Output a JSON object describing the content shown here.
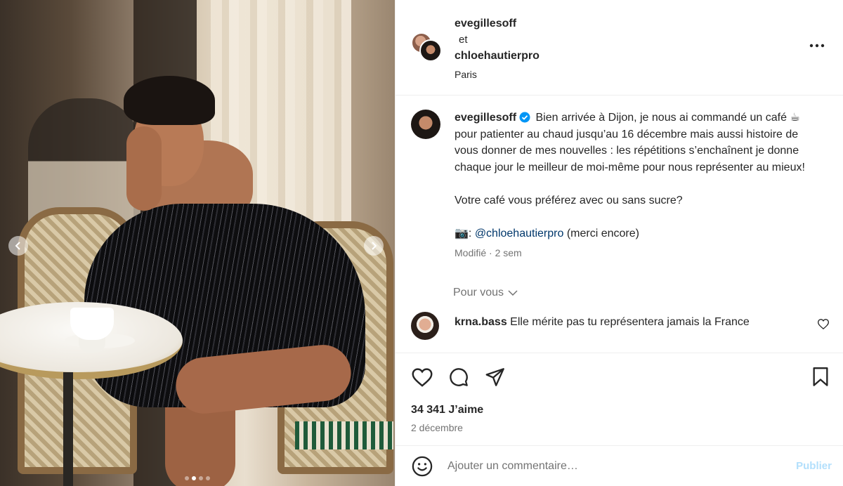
{
  "header": {
    "user1": "evegillesoff",
    "conjunction": "et",
    "user2": "chloehautierpro",
    "location": "Paris"
  },
  "caption": {
    "username": "evegillesoff",
    "text_part1": "Bien arrivée à Dijon, je nous ai commandé un café ☕ pour patienter au chaud jusqu’au 16 décembre mais aussi histoire de vous donner de mes nouvelles : les répétitions s’enchaînent je donne chaque jour le meilleur de moi-même pour nous représenter au mieux!",
    "text_part2": "Votre café vous préférez avec ou sans sucre?",
    "camera_emoji": "📷",
    "mention": "@chloehautierpro",
    "mention_suffix": "(merci encore)",
    "meta": "Modifié · 2 sem"
  },
  "pour_vous": "Pour vous",
  "comment": {
    "username": "krna.bass",
    "text": "Elle mérite pas tu représentera jamais la France"
  },
  "likes": "34 341 J’aime",
  "date": "2 décembre",
  "add_comment": {
    "placeholder": "Ajouter un commentaire…",
    "post_label": "Publier"
  },
  "carousel": {
    "current": 2,
    "total": 4
  },
  "colors": {
    "text": "#262626",
    "muted": "#737373",
    "link": "#00376b",
    "verified": "#0095f6",
    "publish_disabled": "#b2dffc"
  },
  "icons": [
    "more-icon",
    "verified-icon",
    "chevron-down-icon",
    "heart-icon",
    "comment-icon",
    "share-icon",
    "bookmark-icon",
    "emoji-icon",
    "chevron-left-icon",
    "chevron-right-icon"
  ]
}
